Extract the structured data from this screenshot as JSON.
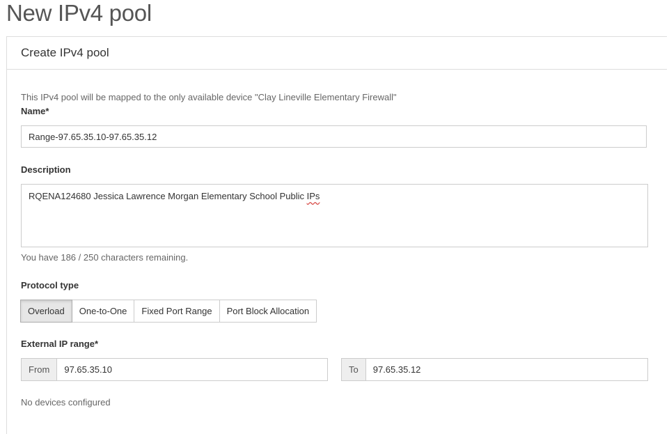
{
  "page": {
    "title": "New IPv4 pool"
  },
  "panel": {
    "heading": "Create IPv4 pool",
    "info": "This IPv4 pool will be mapped to the only available device \"Clay Lineville Elementary Firewall\""
  },
  "name_field": {
    "label": "Name*",
    "value": "Range-97.65.35.10-97.65.35.12"
  },
  "description_field": {
    "label": "Description",
    "value_main": "RQENA124680 Jessica Lawrence Morgan Elementary School Public ",
    "value_flagged": "IPs",
    "helper": "You have 186 / 250 characters remaining."
  },
  "protocol": {
    "label": "Protocol type",
    "options": [
      "Overload",
      "One-to-One",
      "Fixed Port Range",
      "Port Block Allocation"
    ],
    "selected": "Overload"
  },
  "external_range": {
    "label": "External IP range*",
    "from_label": "From",
    "from_value": "97.65.35.10",
    "to_label": "To",
    "to_value": "97.65.35.12"
  },
  "devices": {
    "status": "No devices configured"
  }
}
